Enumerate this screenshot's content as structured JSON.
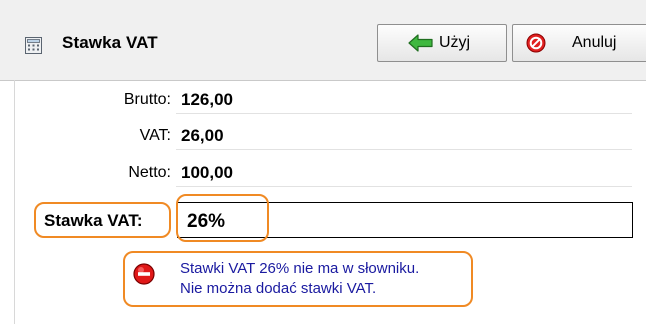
{
  "window": {
    "title": "Stawka VAT",
    "icon": "calculator-icon"
  },
  "toolbar": {
    "use_label": "Użyj",
    "use_icon": "arrow-left-icon",
    "cancel_label": "Anuluj",
    "cancel_icon": "no-entry-icon"
  },
  "amounts": {
    "brutto_label": "Brutto:",
    "brutto_value": "126,00",
    "vat_label": "VAT:",
    "vat_value": "26,00",
    "netto_label": "Netto:",
    "netto_value": "100,00"
  },
  "rate": {
    "label": "Stawka VAT:",
    "value": "26%"
  },
  "error": {
    "icon": "error-stop-icon",
    "line1": "Stawki VAT 26% nie ma w słowniku.",
    "line2": "Nie można dodać stawki VAT."
  },
  "colors": {
    "highlight": "#f08a24",
    "error_text": "#1a1aa0",
    "error_icon": "#d40000",
    "arrow_green": "#2e9e2e"
  }
}
